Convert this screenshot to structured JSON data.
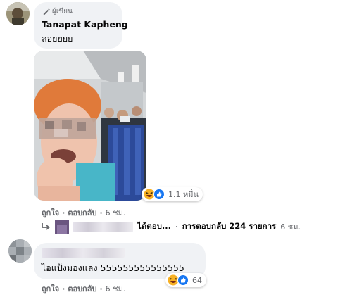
{
  "comments": [
    {
      "badge": "ผู้เขียน",
      "author": "Tanapat Kapheng",
      "text": "ลอยยยย",
      "reaction_count": "1.1 หมื่น",
      "actions": {
        "like": "ถูกใจ",
        "reply": "ตอบกลับ",
        "time": "6 ชม."
      },
      "reply_summary": {
        "replied_suffix": "ได้ตอบ...",
        "separator": "·",
        "count_text": "การตอบกลับ 224 รายการ",
        "time": "6 ชม."
      }
    },
    {
      "text": "ไอแป้งมองแลง 555555555555555",
      "reaction_count": "64",
      "actions": {
        "like": "ถูกใจ",
        "reply": "ตอบกลับ",
        "time": "6 ชม."
      }
    }
  ],
  "icons": {
    "author_badge": "pencil-icon",
    "reply": "reply-arrow-icon",
    "reactions": [
      "haha-reaction-icon",
      "like-reaction-icon"
    ]
  },
  "colors": {
    "like_blue": "#1877f2",
    "haha_yellow": "#f7b125",
    "meta_gray": "#65676b",
    "bubble_bg": "#f0f2f5"
  }
}
